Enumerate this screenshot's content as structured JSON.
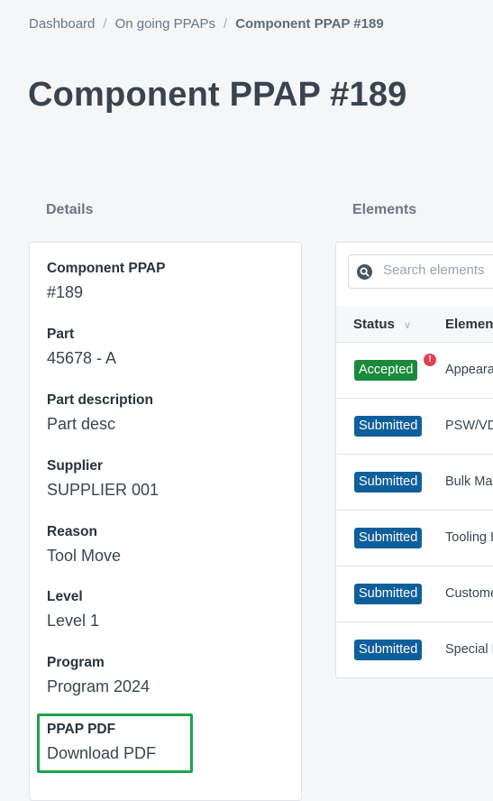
{
  "breadcrumb": {
    "items": [
      "Dashboard",
      "On going PPAPs"
    ],
    "current": "Component PPAP #189"
  },
  "page": {
    "title": "Component PPAP #189"
  },
  "details": {
    "heading": "Details",
    "fields": [
      {
        "label": "Component PPAP",
        "value": "#189"
      },
      {
        "label": "Part",
        "value": "45678 - A"
      },
      {
        "label": "Part description",
        "value": "Part desc"
      },
      {
        "label": "Supplier",
        "value": "SUPPLIER 001"
      },
      {
        "label": "Reason",
        "value": "Tool Move"
      },
      {
        "label": "Level",
        "value": "Level 1"
      },
      {
        "label": "Program",
        "value": "Program 2024"
      },
      {
        "label": "PPAP PDF",
        "value": "Download PDF"
      }
    ]
  },
  "elements": {
    "heading": "Elements",
    "search_placeholder": "Search elements",
    "columns": [
      "Status",
      "Element"
    ],
    "rows": [
      {
        "status": "Accepted",
        "name": "Appeara",
        "alert": "!"
      },
      {
        "status": "Submitted",
        "name": "PSW/VD"
      },
      {
        "status": "Submitted",
        "name": "Bulk Ma"
      },
      {
        "status": "Submitted",
        "name": "Tooling I"
      },
      {
        "status": "Submitted",
        "name": "Custome"
      },
      {
        "status": "Submitted",
        "name": "Special F"
      }
    ]
  },
  "colors": {
    "accepted": "#1a8a3c",
    "submitted": "#0f5f9c",
    "alert": "#e0404f",
    "highlight": "#1fa34a"
  },
  "icons": {
    "search": "search-icon",
    "sort": "chevron-down-icon",
    "alert": "alert-icon"
  }
}
